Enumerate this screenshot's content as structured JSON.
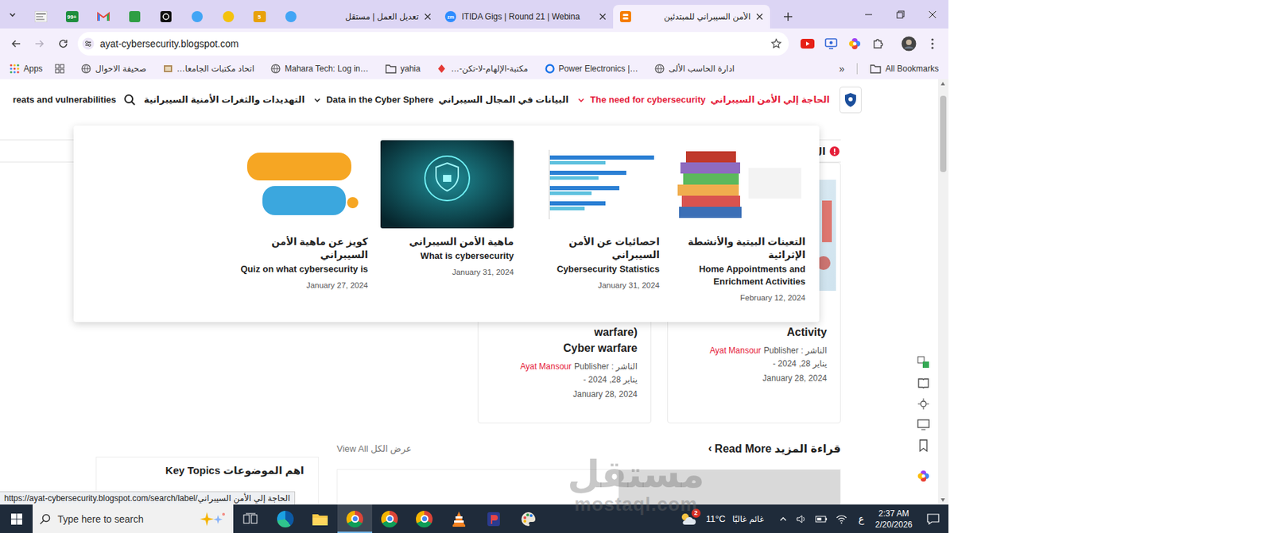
{
  "browser": {
    "pinned_tabs": [
      {
        "kind": "thumb"
      },
      {
        "kind": "badge",
        "text": "99+",
        "color": "#1e8e3e"
      },
      {
        "kind": "gmail"
      },
      {
        "kind": "square",
        "color": "#2f9e44"
      },
      {
        "kind": "dark"
      },
      {
        "kind": "circle",
        "color": "#42a5f5"
      },
      {
        "kind": "circle",
        "color": "#f4c20d"
      },
      {
        "kind": "badge",
        "text": "5",
        "color": "#e8a10a"
      },
      {
        "kind": "circle",
        "color": "#42a5f5"
      }
    ],
    "tabs": [
      {
        "label": "تعديل العمل | مستقل",
        "kind": "none",
        "selected": false
      },
      {
        "label": "ITIDA Gigs | Round 21 | Webina",
        "kind": "zoom",
        "icon_text": "zm",
        "selected": false
      },
      {
        "label": "الأمن السيبراني للمبتدئين",
        "kind": "blogger",
        "selected": true
      }
    ],
    "forward_disabled": true,
    "url": "ayat-cybersecurity.blogspot.com",
    "apps_label": "Apps",
    "bookmarks": [
      {
        "label": "صحيفة الاحوال",
        "kind": "globe"
      },
      {
        "label": "اتحاد مكتبات الجامعا…",
        "kind": "image"
      },
      {
        "label": "Mahara Tech: Log in…",
        "kind": "globe"
      },
      {
        "label": "yahia",
        "kind": "folder"
      },
      {
        "label": "مكتبة-الإلهام-لا-تكن-…",
        "kind": "red"
      },
      {
        "label": "Power Electronics |…",
        "kind": "blue"
      },
      {
        "label": "ادارة الحاسب الألى",
        "kind": "globe"
      }
    ],
    "more": "»",
    "all_bookmarks": "All Bookmarks",
    "status_url": "https://ayat-cybersecurity.blogspot.com/search/label/الحاجة إلي الأمن السيبراني"
  },
  "site": {
    "nav": [
      {
        "ar": "الحاجة إلي الأمن السيبراني",
        "en": "The need for cybersecurity",
        "selected": true,
        "dropdown": true
      },
      {
        "ar": "البيانات في المجال السيبراني",
        "en": "Data in the Cyber Sphere",
        "selected": false,
        "dropdown": true
      },
      {
        "ar": "التهديدات والثغرات الأمنية السيبرانية",
        "en": "reats and vulnerabilities",
        "selected": false,
        "dropdown": false
      }
    ],
    "ticker": "ال",
    "menu_posts": [
      {
        "ar": "التعينات البيتية والأنشطة الإثرائية",
        "en": "Home Appointments and Enrichment Activities",
        "date": "February 12, 2024",
        "kind": "books"
      },
      {
        "ar": "احصائيات عن الأمن السيبراني",
        "en": "Cybersecurity Statistics",
        "date": "January 31, 2024",
        "kind": "chart"
      },
      {
        "ar": "ماهية الأمن السيبراني",
        "en": "What is cybersecurity",
        "date": "January 31, 2024",
        "kind": "cyber"
      },
      {
        "ar": "كويز عن ماهية الأمن السيبراني",
        "en": "Quiz on what cybersecurity is",
        "date": "January 27, 2024",
        "kind": "quiz"
      }
    ],
    "posts": [
      {
        "lines": [
          "Activity"
        ],
        "publisher": "الناشر : Publisher",
        "author": "Ayat Mansour",
        "ar_date": "- يناير 28, 2024",
        "date": "January 28, 2024"
      },
      {
        "lines": [
          "(warfare",
          "Cyber warfare"
        ],
        "publisher": "الناشر : Publisher",
        "author": "Ayat Mansour",
        "ar_date": "- يناير 28, 2024",
        "date": "January 28, 2024"
      }
    ],
    "read_more": "قراءة المزيد Read More",
    "read_more_arrow": "›",
    "view_all": "عرض الكل View All",
    "key_topics": "اهم الموضوعات Key Topics"
  },
  "watermark": {
    "ar": "مستقل",
    "en": "mostaql.com"
  },
  "taskbar": {
    "search_placeholder": "Type here to search",
    "apps": [
      {
        "kind": "taskview",
        "selected": false
      },
      {
        "kind": "edge",
        "selected": false
      },
      {
        "kind": "explorer",
        "selected": false
      },
      {
        "kind": "chrome",
        "selected": true
      },
      {
        "kind": "chrome",
        "selected": false
      },
      {
        "kind": "chrome",
        "selected": false
      },
      {
        "kind": "vlc",
        "selected": false
      },
      {
        "kind": "app",
        "selected": false
      },
      {
        "kind": "paint",
        "selected": false
      }
    ],
    "weather": {
      "badge": "2",
      "temp": "11°C",
      "condition": "غائم غالبًا"
    },
    "lang": "ع",
    "time": "2:37 AM",
    "date": "2/20/2026"
  }
}
